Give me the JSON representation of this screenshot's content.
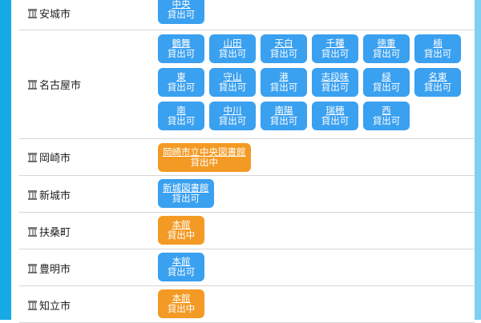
{
  "status_colors": {
    "available": "#3aa0f0",
    "on_loan": "#f39a24"
  },
  "icon": "library-building-icon",
  "rows": [
    {
      "city": "安城市",
      "libraries": [
        {
          "name": "中央",
          "status": "貸出可",
          "color": "blue"
        }
      ]
    },
    {
      "city": "名古屋市",
      "libraries": [
        {
          "name": "鶴舞",
          "status": "貸出可",
          "color": "blue"
        },
        {
          "name": "山田",
          "status": "貸出可",
          "color": "blue"
        },
        {
          "name": "天白",
          "status": "貸出可",
          "color": "blue"
        },
        {
          "name": "千種",
          "status": "貸出可",
          "color": "blue"
        },
        {
          "name": "徳重",
          "status": "貸出可",
          "color": "blue"
        },
        {
          "name": "楠",
          "status": "貸出可",
          "color": "blue"
        },
        {
          "name": "東",
          "status": "貸出可",
          "color": "blue"
        },
        {
          "name": "守山",
          "status": "貸出可",
          "color": "blue"
        },
        {
          "name": "港",
          "status": "貸出可",
          "color": "blue"
        },
        {
          "name": "志段味",
          "status": "貸出可",
          "color": "blue"
        },
        {
          "name": "緑",
          "status": "貸出可",
          "color": "blue"
        },
        {
          "name": "名東",
          "status": "貸出可",
          "color": "blue"
        },
        {
          "name": "南",
          "status": "貸出可",
          "color": "blue"
        },
        {
          "name": "中川",
          "status": "貸出可",
          "color": "blue"
        },
        {
          "name": "南陽",
          "status": "貸出可",
          "color": "blue"
        },
        {
          "name": "瑞穂",
          "status": "貸出可",
          "color": "blue"
        },
        {
          "name": "西",
          "status": "貸出可",
          "color": "blue"
        }
      ]
    },
    {
      "city": "岡崎市",
      "libraries": [
        {
          "name": "岡崎市立中央図書館",
          "status": "貸出中",
          "color": "orange"
        }
      ]
    },
    {
      "city": "新城市",
      "libraries": [
        {
          "name": "新城図書館",
          "status": "貸出可",
          "color": "blue"
        }
      ]
    },
    {
      "city": "扶桑町",
      "libraries": [
        {
          "name": "本館",
          "status": "貸出中",
          "color": "orange"
        }
      ]
    },
    {
      "city": "豊明市",
      "libraries": [
        {
          "name": "本館",
          "status": "貸出可",
          "color": "blue"
        }
      ]
    },
    {
      "city": "知立市",
      "libraries": [
        {
          "name": "本館",
          "status": "貸出中",
          "color": "orange"
        }
      ]
    }
  ]
}
